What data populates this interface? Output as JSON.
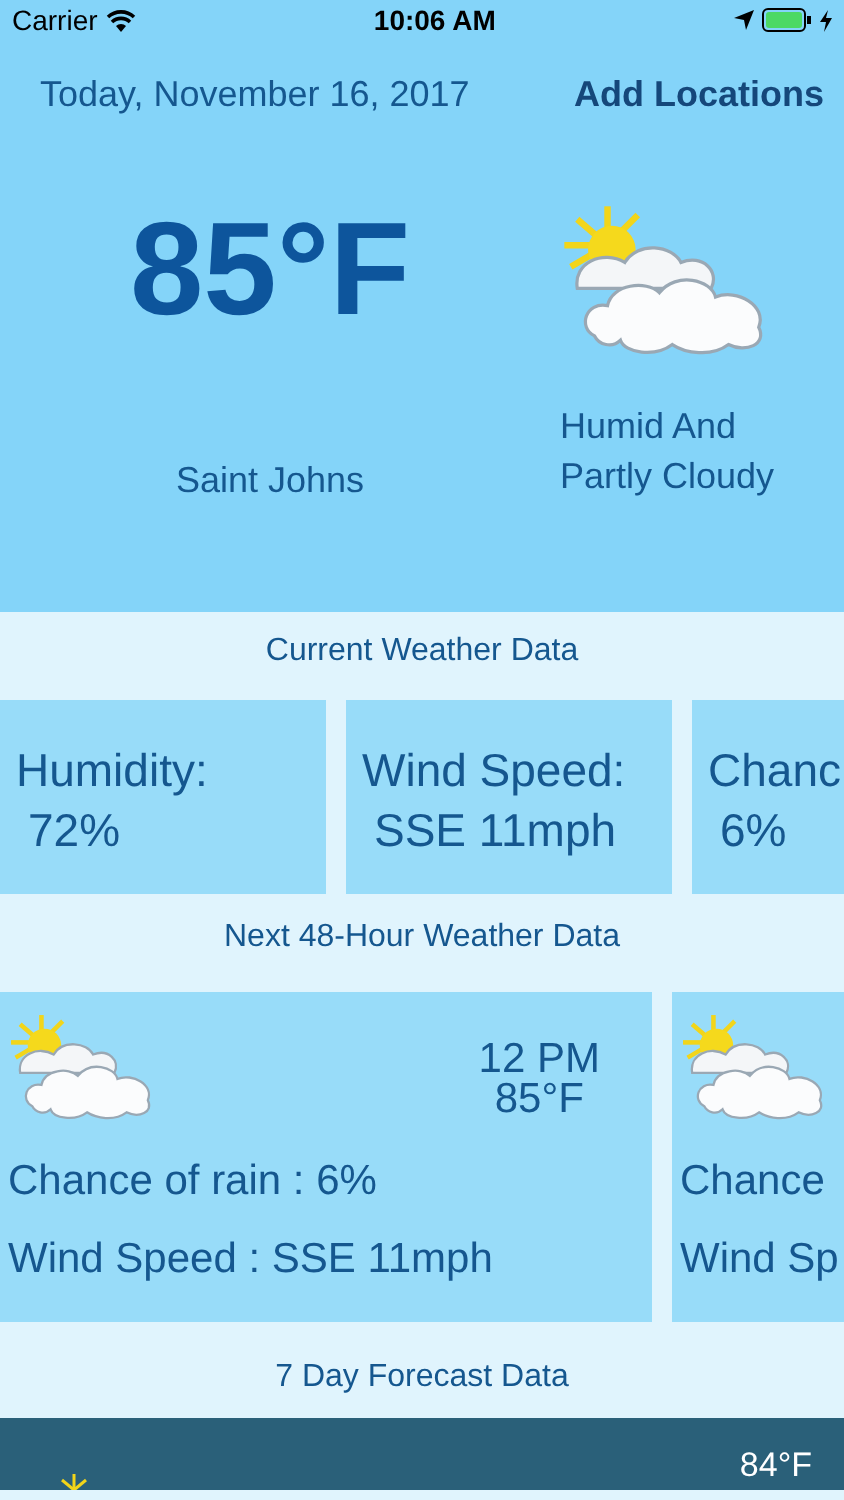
{
  "status_bar": {
    "carrier": "Carrier",
    "time": "10:06 AM"
  },
  "header": {
    "date": "Today, November 16, 2017",
    "action": "Add Locations"
  },
  "current": {
    "temperature": "85°F",
    "location": "Saint Johns",
    "condition_lines": [
      "Humid And",
      "Partly Cloudy"
    ]
  },
  "current_section": {
    "title": "Current Weather Data",
    "cards": [
      {
        "label": "Humidity:",
        "value": "72%"
      },
      {
        "label": "Wind Speed:",
        "value": "SSE 11mph"
      },
      {
        "label": "Chanc",
        "value": "6%"
      }
    ]
  },
  "hourly_section": {
    "title": "Next 48-Hour Weather Data",
    "cards": [
      {
        "time": "12 PM",
        "temperature": "85°F",
        "rain": "Chance of rain : 6%",
        "wind": "Wind Speed : SSE 11mph"
      },
      {
        "rain": "Chance",
        "wind": "Wind Sp"
      }
    ]
  },
  "daily_section": {
    "title": "7 Day Forecast Data",
    "rows": [
      {
        "temperature": "84°F"
      }
    ]
  }
}
